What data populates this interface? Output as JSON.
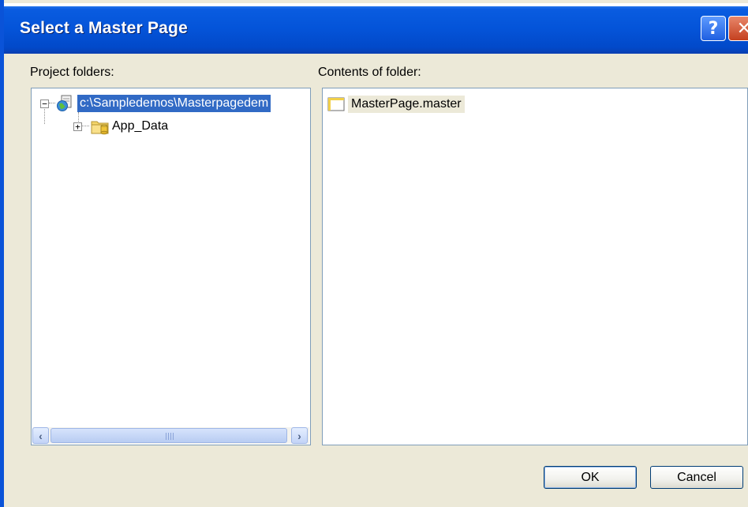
{
  "window": {
    "title": "Select a Master Page",
    "help_glyph": "?",
    "close_glyph": "✕"
  },
  "project_folders": {
    "label": "Project folders:",
    "root": {
      "label": "c:\\Sampledemos\\Masterpagedem",
      "expander": "−",
      "icon": "web-project-icon",
      "selected": true
    },
    "children": [
      {
        "label": "App_Data",
        "expander": "+",
        "icon": "app-data-folder-icon"
      }
    ],
    "scroll_left_glyph": "‹",
    "scroll_right_glyph": "›"
  },
  "contents": {
    "label": "Contents of folder:",
    "items": [
      {
        "label": "MasterPage.master",
        "icon": "master-page-file-icon"
      }
    ]
  },
  "buttons": {
    "ok": "OK",
    "cancel": "Cancel"
  },
  "colors": {
    "title_bar": "#0454d9",
    "dialog_bg": "#ece9d8",
    "selection": "#316ac5"
  }
}
